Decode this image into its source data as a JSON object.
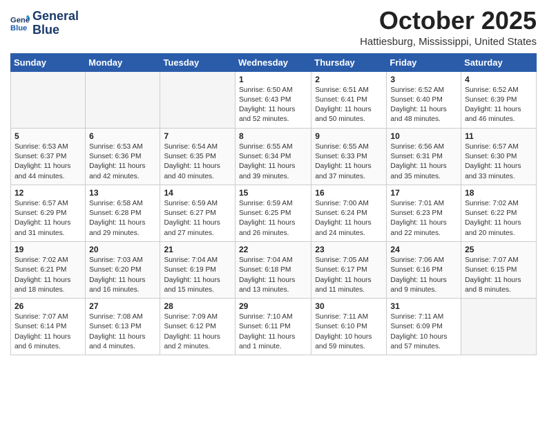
{
  "header": {
    "logo_line1": "General",
    "logo_line2": "Blue",
    "month": "October 2025",
    "location": "Hattiesburg, Mississippi, United States"
  },
  "days_of_week": [
    "Sunday",
    "Monday",
    "Tuesday",
    "Wednesday",
    "Thursday",
    "Friday",
    "Saturday"
  ],
  "weeks": [
    [
      {
        "day": "",
        "empty": true
      },
      {
        "day": "",
        "empty": true
      },
      {
        "day": "",
        "empty": true
      },
      {
        "day": "1",
        "sunrise": "6:50 AM",
        "sunset": "6:43 PM",
        "daylight": "11 hours and 52 minutes."
      },
      {
        "day": "2",
        "sunrise": "6:51 AM",
        "sunset": "6:41 PM",
        "daylight": "11 hours and 50 minutes."
      },
      {
        "day": "3",
        "sunrise": "6:52 AM",
        "sunset": "6:40 PM",
        "daylight": "11 hours and 48 minutes."
      },
      {
        "day": "4",
        "sunrise": "6:52 AM",
        "sunset": "6:39 PM",
        "daylight": "11 hours and 46 minutes."
      }
    ],
    [
      {
        "day": "5",
        "sunrise": "6:53 AM",
        "sunset": "6:37 PM",
        "daylight": "11 hours and 44 minutes."
      },
      {
        "day": "6",
        "sunrise": "6:53 AM",
        "sunset": "6:36 PM",
        "daylight": "11 hours and 42 minutes."
      },
      {
        "day": "7",
        "sunrise": "6:54 AM",
        "sunset": "6:35 PM",
        "daylight": "11 hours and 40 minutes."
      },
      {
        "day": "8",
        "sunrise": "6:55 AM",
        "sunset": "6:34 PM",
        "daylight": "11 hours and 39 minutes."
      },
      {
        "day": "9",
        "sunrise": "6:55 AM",
        "sunset": "6:33 PM",
        "daylight": "11 hours and 37 minutes."
      },
      {
        "day": "10",
        "sunrise": "6:56 AM",
        "sunset": "6:31 PM",
        "daylight": "11 hours and 35 minutes."
      },
      {
        "day": "11",
        "sunrise": "6:57 AM",
        "sunset": "6:30 PM",
        "daylight": "11 hours and 33 minutes."
      }
    ],
    [
      {
        "day": "12",
        "sunrise": "6:57 AM",
        "sunset": "6:29 PM",
        "daylight": "11 hours and 31 minutes."
      },
      {
        "day": "13",
        "sunrise": "6:58 AM",
        "sunset": "6:28 PM",
        "daylight": "11 hours and 29 minutes."
      },
      {
        "day": "14",
        "sunrise": "6:59 AM",
        "sunset": "6:27 PM",
        "daylight": "11 hours and 27 minutes."
      },
      {
        "day": "15",
        "sunrise": "6:59 AM",
        "sunset": "6:25 PM",
        "daylight": "11 hours and 26 minutes."
      },
      {
        "day": "16",
        "sunrise": "7:00 AM",
        "sunset": "6:24 PM",
        "daylight": "11 hours and 24 minutes."
      },
      {
        "day": "17",
        "sunrise": "7:01 AM",
        "sunset": "6:23 PM",
        "daylight": "11 hours and 22 minutes."
      },
      {
        "day": "18",
        "sunrise": "7:02 AM",
        "sunset": "6:22 PM",
        "daylight": "11 hours and 20 minutes."
      }
    ],
    [
      {
        "day": "19",
        "sunrise": "7:02 AM",
        "sunset": "6:21 PM",
        "daylight": "11 hours and 18 minutes."
      },
      {
        "day": "20",
        "sunrise": "7:03 AM",
        "sunset": "6:20 PM",
        "daylight": "11 hours and 16 minutes."
      },
      {
        "day": "21",
        "sunrise": "7:04 AM",
        "sunset": "6:19 PM",
        "daylight": "11 hours and 15 minutes."
      },
      {
        "day": "22",
        "sunrise": "7:04 AM",
        "sunset": "6:18 PM",
        "daylight": "11 hours and 13 minutes."
      },
      {
        "day": "23",
        "sunrise": "7:05 AM",
        "sunset": "6:17 PM",
        "daylight": "11 hours and 11 minutes."
      },
      {
        "day": "24",
        "sunrise": "7:06 AM",
        "sunset": "6:16 PM",
        "daylight": "11 hours and 9 minutes."
      },
      {
        "day": "25",
        "sunrise": "7:07 AM",
        "sunset": "6:15 PM",
        "daylight": "11 hours and 8 minutes."
      }
    ],
    [
      {
        "day": "26",
        "sunrise": "7:07 AM",
        "sunset": "6:14 PM",
        "daylight": "11 hours and 6 minutes."
      },
      {
        "day": "27",
        "sunrise": "7:08 AM",
        "sunset": "6:13 PM",
        "daylight": "11 hours and 4 minutes."
      },
      {
        "day": "28",
        "sunrise": "7:09 AM",
        "sunset": "6:12 PM",
        "daylight": "11 hours and 2 minutes."
      },
      {
        "day": "29",
        "sunrise": "7:10 AM",
        "sunset": "6:11 PM",
        "daylight": "11 hours and 1 minute."
      },
      {
        "day": "30",
        "sunrise": "7:11 AM",
        "sunset": "6:10 PM",
        "daylight": "10 hours and 59 minutes."
      },
      {
        "day": "31",
        "sunrise": "7:11 AM",
        "sunset": "6:09 PM",
        "daylight": "10 hours and 57 minutes."
      },
      {
        "day": "",
        "empty": true
      }
    ]
  ]
}
